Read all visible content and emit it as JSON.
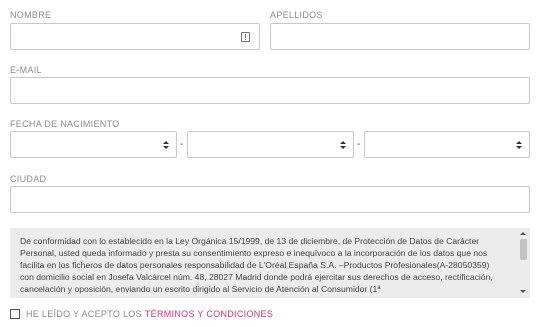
{
  "form": {
    "nombre": {
      "label": "NOMBRE",
      "value": "",
      "icon": "keyboard-warning-icon"
    },
    "apellidos": {
      "label": "APELLIDOS",
      "value": ""
    },
    "email": {
      "label": "E-MAIL",
      "value": ""
    },
    "fecha": {
      "label": "FECHA DE NACIMIENTO",
      "separator": "-",
      "day": "",
      "month": "",
      "year": ""
    },
    "ciudad": {
      "label": "CIUDAD",
      "value": ""
    }
  },
  "legal": {
    "text": "De conformidad con lo establecido en la Ley Orgánica 15/1999, de 13 de diciembre, de Protección de Datos de Carácter Personal, usted queda informado y presta su consentimiento expreso e inequívoco a la incorporación de los datos que nos facilita en los ficheros de datos personales responsabilidad de L'Oréal España S.A. –Productos Profesionales(A-28050359) con domicilio social en Josefa Valcárcel núm. 48, 28027 Madrid donde podrá ejercitar sus derechos de acceso, rectificación, cancelación y oposición, enviando un escrito dirigido al Servicio de Atención al Consumidor (1ª"
  },
  "consent": {
    "prefix": "HE LEÍDO Y ACEPTO LOS",
    "link": "TÉRMINOS Y CONDICIONES",
    "checked": false
  },
  "colors": {
    "accent": "#e8307b",
    "label": "#8c8c8c",
    "legal_bg": "#ececec"
  }
}
